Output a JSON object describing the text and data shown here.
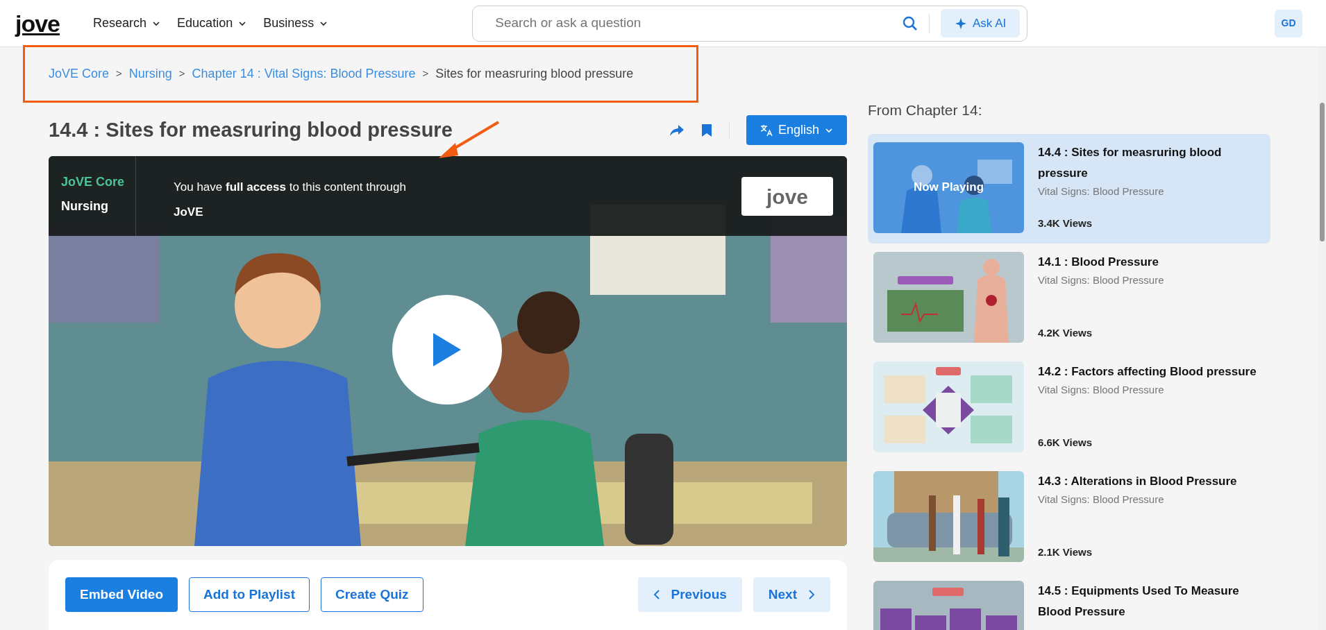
{
  "header": {
    "logo": "jove",
    "nav": [
      {
        "label": "Research"
      },
      {
        "label": "Education"
      },
      {
        "label": "Business"
      }
    ],
    "search": {
      "placeholder": "Search or ask a question"
    },
    "ask_ai": "Ask AI",
    "avatar": "GD"
  },
  "breadcrumb": {
    "separator": ">",
    "items": [
      {
        "label": "JoVE Core",
        "link": true
      },
      {
        "label": "Nursing",
        "link": true
      },
      {
        "label": "Chapter 14 : Vital Signs: Blood Pressure",
        "link": true
      },
      {
        "label": "Sites for measruring blood pressure",
        "link": false
      }
    ]
  },
  "title": "14.4 : Sites for measruring blood pressure",
  "language": "English",
  "video": {
    "section": "JoVE Core",
    "subject": "Nursing",
    "message": "You have **full access** to this content through",
    "institution": "JoVE",
    "logo": "jove"
  },
  "buttons": [
    {
      "label": "Embed Video",
      "kind": "primary"
    },
    {
      "label": "Add to Playlist",
      "kind": "outline"
    },
    {
      "label": "Create Quiz",
      "kind": "outline"
    }
  ],
  "pager": [
    {
      "label": "Previous",
      "kind": "prev"
    },
    {
      "label": "Next",
      "kind": "next"
    }
  ],
  "sidebar": {
    "heading": "From Chapter 14:",
    "items": [
      {
        "title": "14.4 : Sites for measruring blood pressure",
        "subtitle": "Vital Signs: Blood Pressure",
        "views": "3.4K Views",
        "selected": true,
        "badge": "Now Playing"
      },
      {
        "title": "14.1 : Blood Pressure",
        "subtitle": "Vital Signs: Blood Pressure",
        "views": "4.2K Views",
        "selected": false
      },
      {
        "title": "14.2 : Factors affecting Blood pressure",
        "subtitle": "Vital Signs: Blood Pressure",
        "views": "6.6K Views",
        "selected": false
      },
      {
        "title": "14.3 : Alterations in Blood Pressure",
        "subtitle": "Vital Signs: Blood Pressure",
        "views": "2.1K Views",
        "selected": false
      },
      {
        "title": "14.5 : Equipments Used To Measure Blood Pressure",
        "selected": false
      }
    ]
  },
  "highlight_box": true,
  "pointer_arrow": true
}
